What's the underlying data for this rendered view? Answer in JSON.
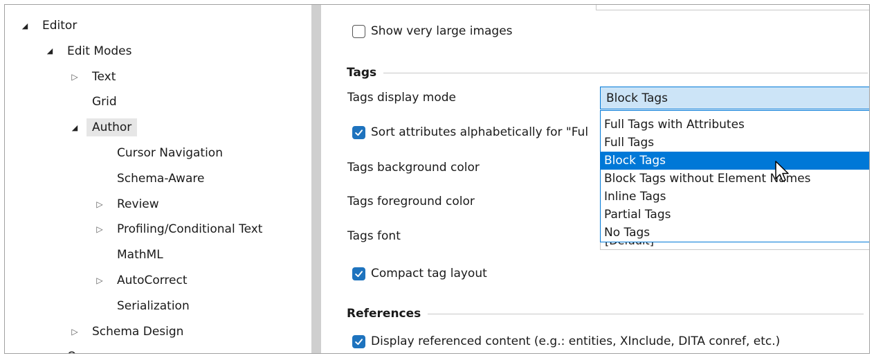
{
  "tree": {
    "items": [
      {
        "label": "Editor",
        "level": 0,
        "arrow": "expanded"
      },
      {
        "label": "Edit Modes",
        "level": 1,
        "arrow": "expanded"
      },
      {
        "label": "Text",
        "level": 2,
        "arrow": "collapsed"
      },
      {
        "label": "Grid",
        "level": 2,
        "arrow": "none"
      },
      {
        "label": "Author",
        "level": 2,
        "arrow": "expanded",
        "selected": true
      },
      {
        "label": "Cursor Navigation",
        "level": 3,
        "arrow": "none"
      },
      {
        "label": "Schema-Aware",
        "level": 3,
        "arrow": "none"
      },
      {
        "label": "Review",
        "level": 3,
        "arrow": "collapsed"
      },
      {
        "label": "Profiling/Conditional Text",
        "level": 3,
        "arrow": "collapsed"
      },
      {
        "label": "MathML",
        "level": 3,
        "arrow": "none"
      },
      {
        "label": "AutoCorrect",
        "level": 3,
        "arrow": "collapsed"
      },
      {
        "label": "Serialization",
        "level": 3,
        "arrow": "none"
      },
      {
        "label": "Schema Design",
        "level": 2,
        "arrow": "collapsed"
      },
      {
        "label": "Open",
        "level": 1,
        "arrow": "none"
      }
    ]
  },
  "content": {
    "show_large_images": {
      "label": "Show very large images",
      "checked": false
    },
    "tags_section": "Tags",
    "tags_display_mode": {
      "label": "Tags display mode",
      "value": "Block Tags",
      "options": [
        "Full Tags with Attributes",
        "Full Tags",
        "Block Tags",
        "Block Tags without Element Names",
        "Inline Tags",
        "Partial Tags",
        "No Tags"
      ],
      "selected_index": 2
    },
    "sort_attributes": {
      "label": "Sort attributes alphabetically for \"Ful",
      "checked": true
    },
    "tags_background_color": {
      "label": "Tags background color"
    },
    "tags_foreground_color": {
      "label": "Tags foreground color"
    },
    "tags_font": {
      "label": "Tags font",
      "value": "[Default]"
    },
    "compact_tag_layout": {
      "label": "Compact tag layout",
      "checked": true
    },
    "references_section": "References",
    "display_referenced": {
      "label": "Display referenced content (e.g.: entities, XInclude, DITA conref, etc.)",
      "checked": true
    }
  },
  "colors": {
    "accent": "#0078d7",
    "checkbox_checked": "#1e73be",
    "combo_bg": "#cce4f7",
    "selection_tree": "#e6e6e6",
    "splitter": "#cfcfcf"
  }
}
